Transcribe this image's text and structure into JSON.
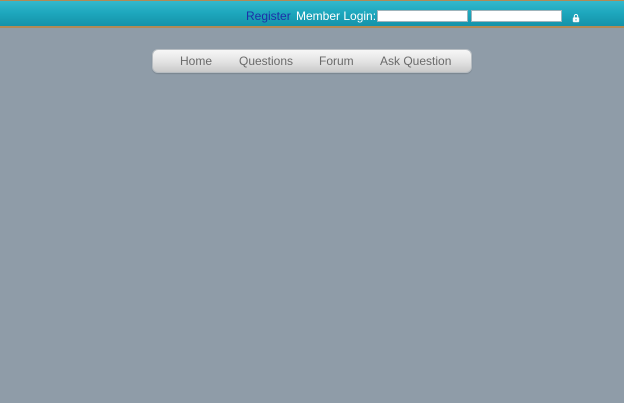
{
  "header": {
    "register_label": "Register",
    "member_login_label": "Member Login:",
    "username_value": "",
    "password_value": "",
    "login_icon": "lock-icon"
  },
  "nav": {
    "items": [
      {
        "label": "Home"
      },
      {
        "label": "Questions"
      },
      {
        "label": "Forum"
      },
      {
        "label": "Ask Question"
      }
    ]
  },
  "colors": {
    "page_background": "#8f9ca8",
    "header_teal": "#1ea8be",
    "header_border": "#b28a55",
    "register_link": "#1d2fa8"
  }
}
